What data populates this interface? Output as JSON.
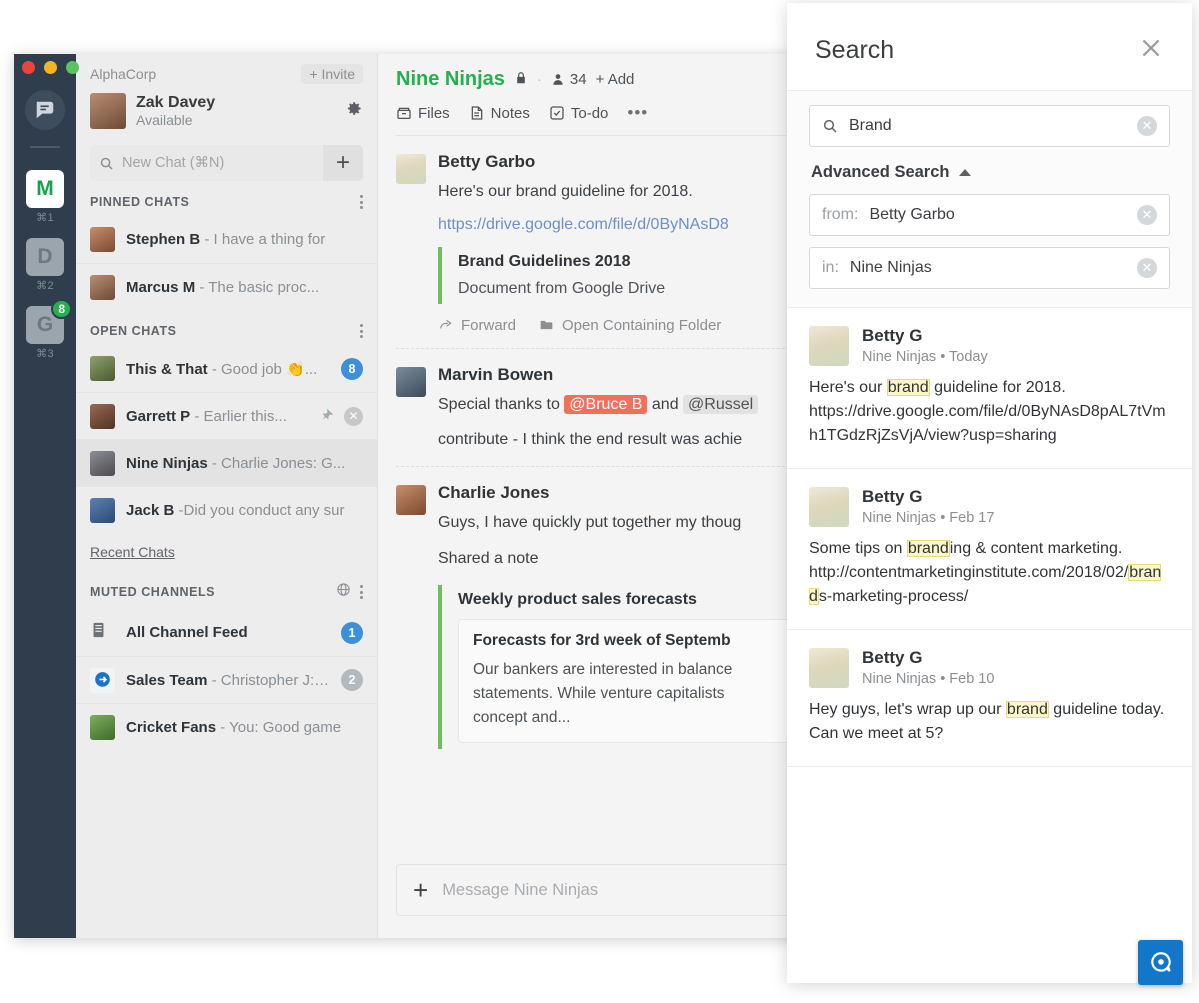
{
  "colors": {
    "accent_green": "#22b14c",
    "rail_bg": "#2f3d4c",
    "badge_blue": "#3b8fdb",
    "mention_red": "#f2705a",
    "highlight_yellow": "#fdf6c8",
    "dock_blue": "#1277c9"
  },
  "rail": {
    "logo_icon": "chat-logo-icon",
    "teams": [
      {
        "letter": "M",
        "shortcut": "⌘1",
        "active": true,
        "badge": ""
      },
      {
        "letter": "D",
        "shortcut": "⌘2",
        "active": false,
        "badge": ""
      },
      {
        "letter": "G",
        "shortcut": "⌘3",
        "active": false,
        "badge": "8"
      }
    ]
  },
  "chat_list": {
    "org_name": "AlphaCorp",
    "invite_label": "+ Invite",
    "me": {
      "name": "Zak Davey",
      "status": "Available"
    },
    "settings_icon": "gear-icon",
    "new_chat_placeholder": "New Chat (⌘N)",
    "new_chat_add_label": "+",
    "sections": [
      {
        "title": "PINNED CHATS",
        "items": [
          {
            "name": "Stephen B",
            "preview": "- I have a thing for",
            "badge": "",
            "avatar": "av1"
          },
          {
            "name": "Marcus M",
            "preview": "- The basic proc...",
            "badge": "",
            "avatar": "av2"
          }
        ]
      },
      {
        "title": "OPEN CHATS",
        "items": [
          {
            "name": "This & That",
            "preview": "- Good job 👏...",
            "badge": "8",
            "badge_style": "blue",
            "avatar": "av3"
          },
          {
            "name": "Garrett P",
            "preview": "- Earlier this...",
            "badge": "",
            "pin": true,
            "close": true,
            "avatar": "av4"
          },
          {
            "name": "Nine Ninjas",
            "preview": "- Charlie Jones: G...",
            "badge": "",
            "selected": true,
            "avatar": "av8"
          },
          {
            "name": "Jack B",
            "preview": "-Did you conduct any sur",
            "badge": "",
            "avatar": "av6"
          }
        ]
      }
    ],
    "recent_chats_label": "Recent Chats",
    "muted": {
      "title": "MUTED CHANNELS",
      "globe_icon": "globe-mute-icon",
      "items": [
        {
          "name": "All Channel Feed",
          "preview": "",
          "badge": "1",
          "badge_style": "blue",
          "avatar": "feed"
        },
        {
          "name": "Sales Team",
          "preview": "- Christopher J: d.",
          "badge": "2",
          "badge_style": "grey",
          "avatar": "sales"
        },
        {
          "name": "Cricket Fans",
          "preview": "- You: Good game",
          "badge": "",
          "avatar": "av9"
        }
      ]
    }
  },
  "conversation": {
    "title": "Nine Ninjas",
    "lock_icon": "lock-icon",
    "member_icon": "person-icon",
    "member_count": "34",
    "add_label": "+ Add",
    "tabs": [
      {
        "label": "Files",
        "icon": "files-icon"
      },
      {
        "label": "Notes",
        "icon": "notes-icon"
      },
      {
        "label": "To-do",
        "icon": "todo-icon"
      }
    ],
    "more_icon": "ellipsis-icon",
    "messages": [
      {
        "author": "Betty Garbo",
        "avatar": "avBetty",
        "lines": [
          "Here's our brand guideline for 2018."
        ],
        "link": "https://drive.google.com/file/d/0ByNAsD8",
        "attachment": {
          "title": "Brand Guidelines 2018",
          "subtitle": "Document from Google Drive",
          "actions": [
            {
              "label": "Forward",
              "icon": "forward-icon"
            },
            {
              "label": "Open Containing Folder",
              "icon": "folder-icon"
            }
          ]
        }
      },
      {
        "author": "Marvin Bowen",
        "avatar": "av5",
        "rich": {
          "pre": "Special thanks to ",
          "mention1": "@Bruce B",
          "mid": " and ",
          "mention2": "@Russel",
          "line2": "contribute - I think the end result was achie"
        }
      },
      {
        "author": "Charlie Jones",
        "avatar": "av1",
        "lines": [
          "Guys, I have quickly put together my thoug",
          "Shared a note"
        ],
        "note": {
          "title": "Weekly product sales forecasts",
          "card_title": "Forecasts for 3rd week of Septemb",
          "card_body": [
            "Our bankers are interested in balance",
            "statements. While venture capitalists",
            "concept and..."
          ]
        }
      }
    ],
    "composer": {
      "plus_label": "+",
      "placeholder": "Message Nine Ninjas"
    }
  },
  "search": {
    "title": "Search",
    "close_icon": "close-icon",
    "query_value": "Brand",
    "query_icon": "search-icon",
    "clear_icon": "clear-icon",
    "advanced_label": "Advanced Search",
    "advanced_toggle_icon": "caret-up-icon",
    "filters": [
      {
        "label": "from:",
        "value": "Betty Garbo"
      },
      {
        "label": "in:",
        "value": "Nine Ninjas"
      }
    ],
    "results": [
      {
        "author": "Betty G",
        "channel": "Nine Ninjas",
        "time": "Today",
        "parts": [
          {
            "t": "Here's our ",
            "hl": false
          },
          {
            "t": "brand",
            "hl": true
          },
          {
            "t": " guideline for 2018. https://drive.google.com/file/d/0ByNAsD8pAL7tVmh1TGdzRjZsVjA/view?usp=sharing",
            "hl": false
          }
        ]
      },
      {
        "author": "Betty G",
        "channel": "Nine Ninjas",
        "time": "Feb 17",
        "parts": [
          {
            "t": "Some tips on ",
            "hl": false
          },
          {
            "t": "brand",
            "hl": true
          },
          {
            "t": "ing & content marketing. http://contentmarketinginstitute.com/2018/02/",
            "hl": false
          },
          {
            "t": "brand",
            "hl": true
          },
          {
            "t": "s-marketing-process/",
            "hl": false
          }
        ]
      },
      {
        "author": "Betty G",
        "channel": "Nine Ninjas",
        "time": "Feb 10",
        "parts": [
          {
            "t": "Hey guys, let's wrap up our ",
            "hl": false
          },
          {
            "t": "brand",
            "hl": true
          },
          {
            "t": " guideline today. Can we meet at 5?",
            "hl": false
          }
        ]
      }
    ]
  },
  "dock": {
    "icon": "app-dock-icon"
  }
}
